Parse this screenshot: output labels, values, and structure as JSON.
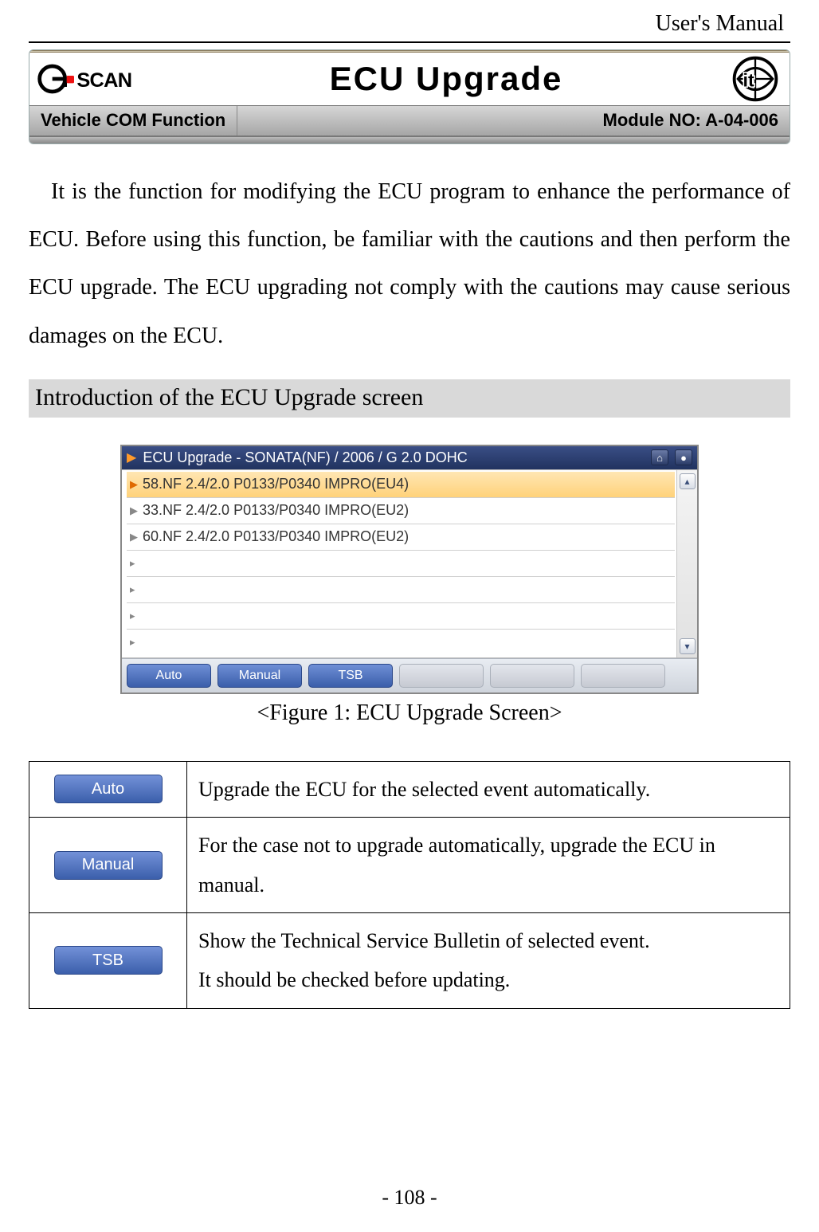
{
  "header": {
    "manual_label": "User's Manual",
    "title": "ECU Upgrade",
    "left_label": "Vehicle COM Function",
    "right_label": "Module NO: A-04-006",
    "logo_left_name": "gscan-logo",
    "logo_right_name": "git-logo"
  },
  "intro_text": "It is the function for modifying the ECU program to enhance the performance of ECU. Before using this function, be familiar with the cautions and then perform the ECU upgrade. The ECU upgrading not comply with the cautions may cause serious damages on the ECU.",
  "section_heading": "Introduction of the ECU Upgrade screen",
  "screenshot": {
    "title": "ECU Upgrade - SONATA(NF) / 2006 / G 2.0 DOHC",
    "rows": [
      "58.NF 2.4/2.0 P0133/P0340 IMPRO(EU4)",
      "33.NF 2.4/2.0 P0133/P0340 IMPRO(EU2)",
      "60.NF 2.4/2.0 P0133/P0340 IMPRO(EU2)"
    ],
    "buttons": {
      "auto": "Auto",
      "manual": "Manual",
      "tsb": "TSB"
    }
  },
  "figure_caption": "<Figure 1: ECU Upgrade Screen>",
  "defs": {
    "auto": {
      "btn": "Auto",
      "desc": "Upgrade the ECU for the selected event automatically."
    },
    "manual": {
      "btn": "Manual",
      "desc": "For the case not to upgrade automatically, upgrade the ECU in manual."
    },
    "tsb": {
      "btn": "TSB",
      "desc_l1": "Show the Technical Service Bulletin of selected event.",
      "desc_l2": "It should be checked before updating."
    }
  },
  "page_number": "- 108 -"
}
